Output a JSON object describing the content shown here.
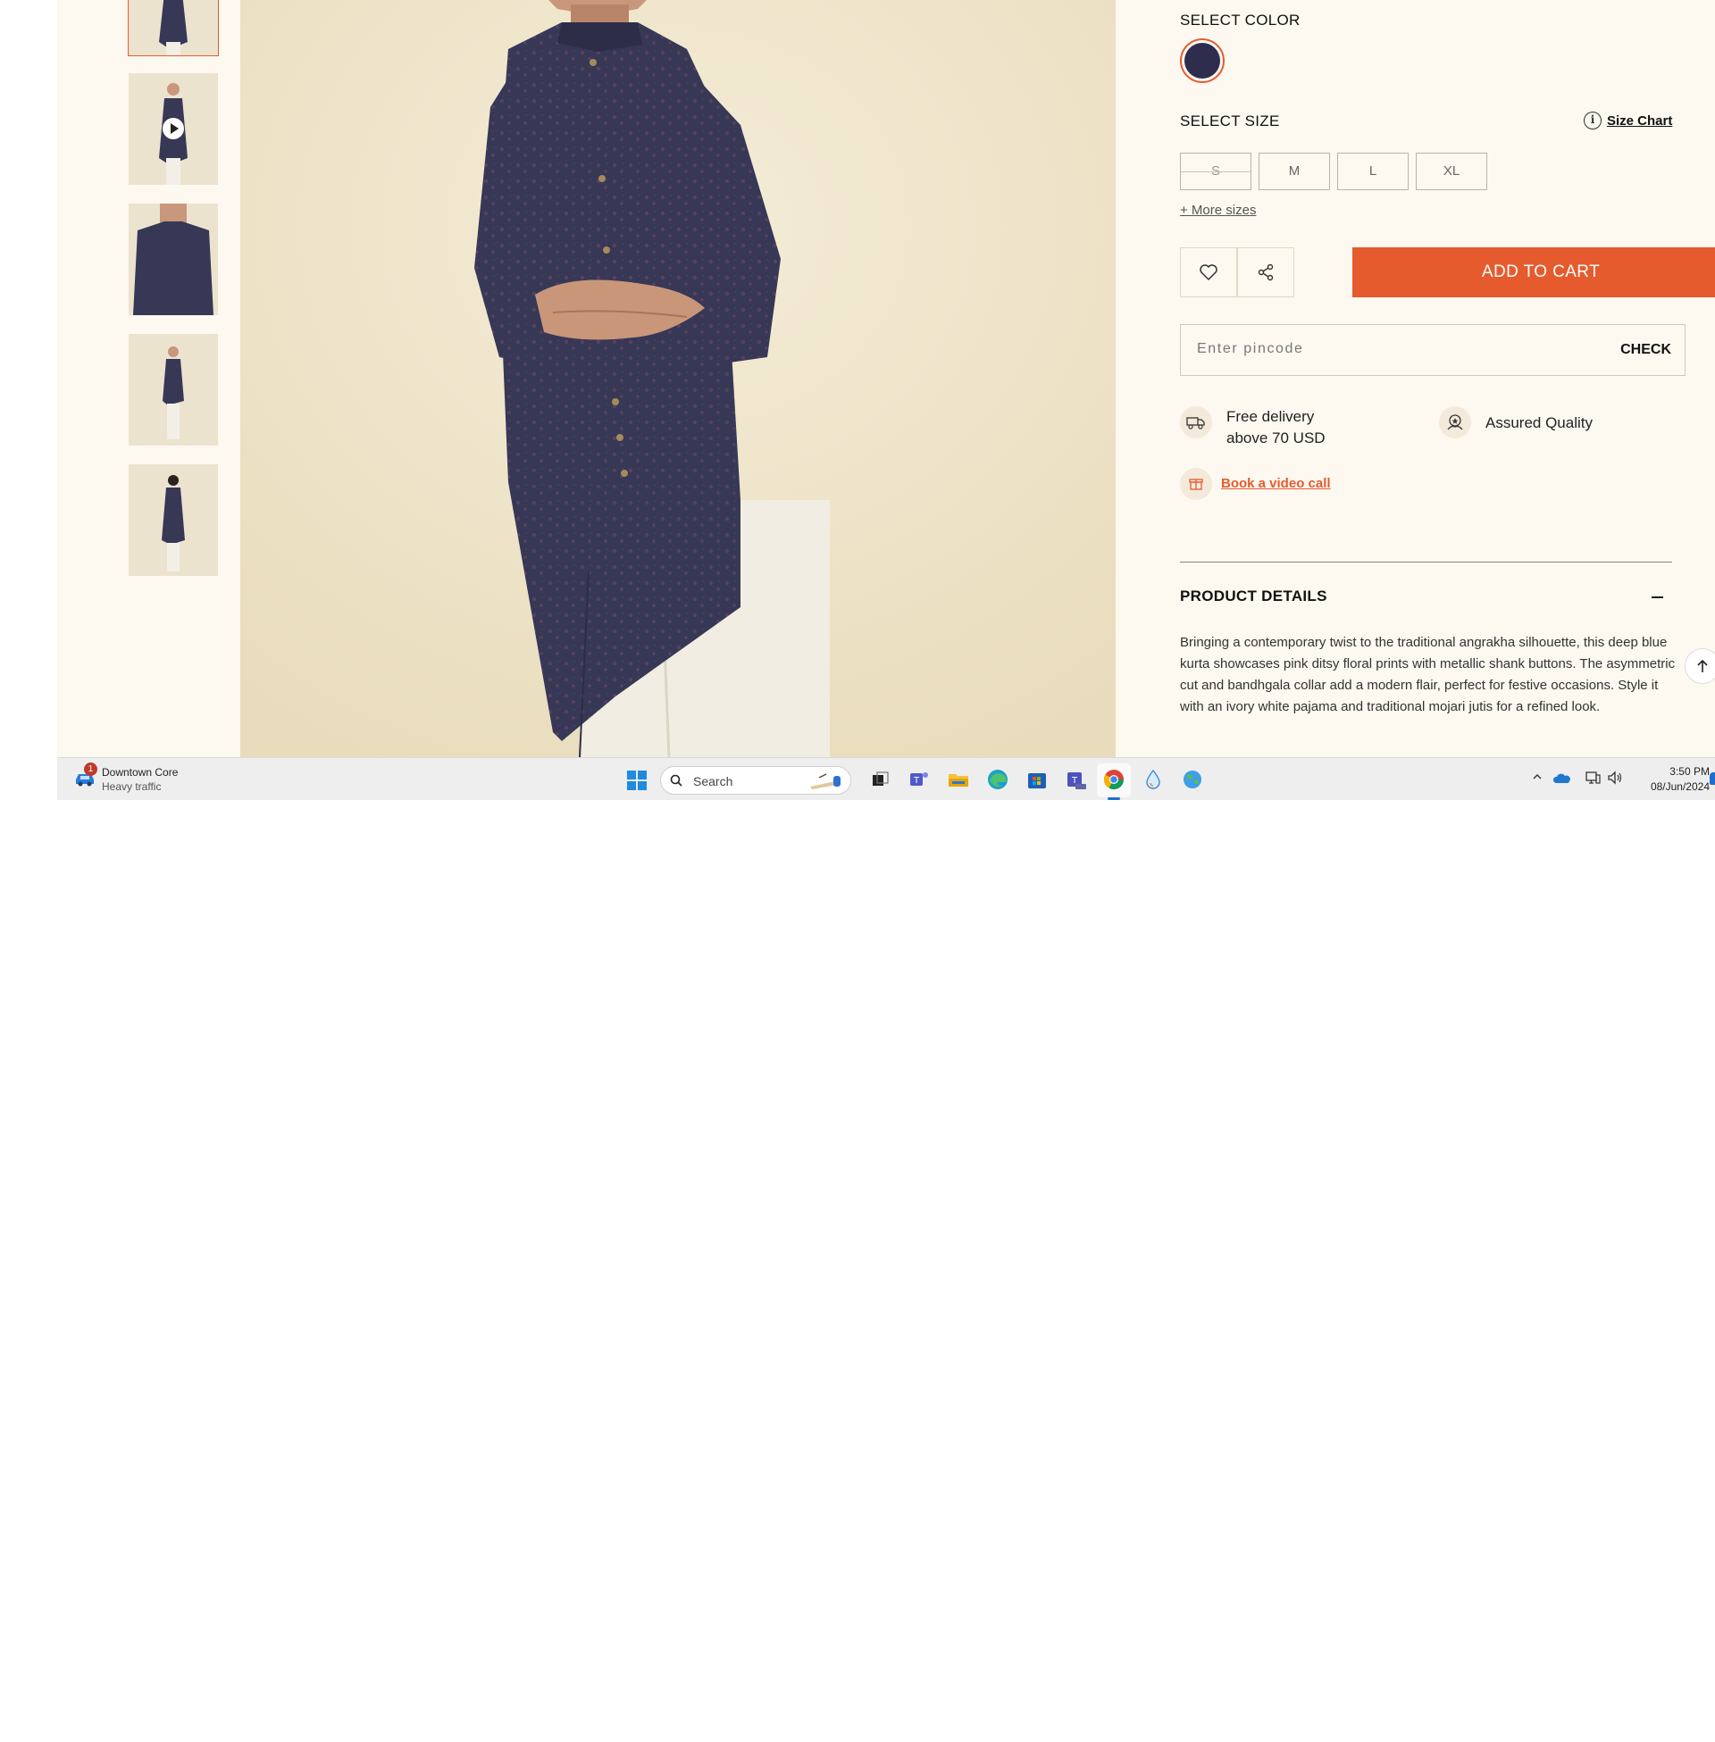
{
  "product": {
    "select_color_label": "SELECT COLOR",
    "select_size_label": "SELECT SIZE",
    "size_chart_label": "Size Chart",
    "sizes": [
      {
        "label": "S",
        "available": false
      },
      {
        "label": "M",
        "available": true
      },
      {
        "label": "L",
        "available": true
      },
      {
        "label": "XL",
        "available": true
      }
    ],
    "more_sizes_label": "+ More sizes",
    "add_to_cart_label": "ADD TO CART",
    "pincode_placeholder": "Enter pincode",
    "check_label": "CHECK",
    "features": {
      "free_delivery_line1": "Free delivery",
      "free_delivery_line2": "above 70 USD",
      "assured_quality": "Assured Quality"
    },
    "video_call_label": "Book a video call",
    "details_title": "PRODUCT DETAILS",
    "details_text": "Bringing a contemporary twist to the traditional angrakha silhouette, this deep blue kurta showcases pink ditsy floral prints with metallic shank buttons. The asymmetric cut and bandhgala collar add a modern flair, perfect for festive occasions. Style it with an ivory white pajama and traditional mojari jutis for a refined look.",
    "colors": {
      "accent": "#e65b2e",
      "kurta": "#363856",
      "background": "#fdf8f0"
    }
  },
  "taskbar": {
    "weather_title": "Downtown Core",
    "weather_subtitle": "Heavy traffic",
    "weather_badge": "1",
    "search_placeholder": "Search",
    "time": "3:50 PM",
    "date": "08/Jun/2024",
    "pinned_apps": [
      "teams-icon",
      "file-explorer-icon",
      "edge-icon",
      "store-icon",
      "teams-new-icon",
      "chrome-icon",
      "drop-app-icon",
      "globe-app-icon"
    ]
  }
}
